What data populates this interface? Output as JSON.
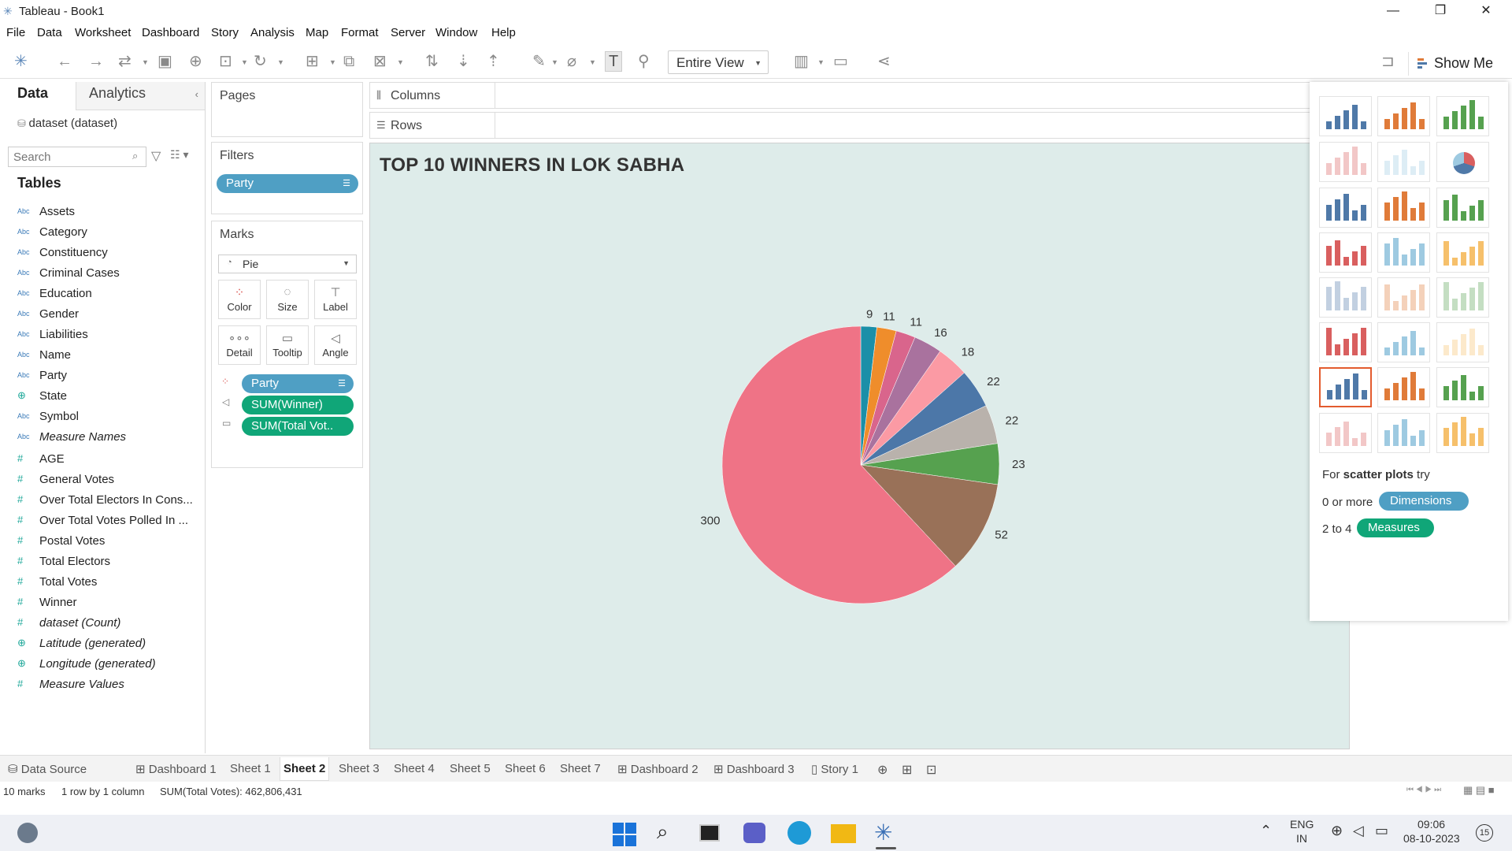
{
  "window": {
    "title": "Tableau - Book1",
    "minimize": "—",
    "restore": "❐",
    "close": "✕"
  },
  "menu": [
    "File",
    "Data",
    "Worksheet",
    "Dashboard",
    "Story",
    "Analysis",
    "Map",
    "Format",
    "Server",
    "Window",
    "Help"
  ],
  "toolbar": {
    "view_mode": "Entire View",
    "show_me": "Show Me"
  },
  "left_pane": {
    "tabs": {
      "data": "Data",
      "analytics": "Analytics"
    },
    "datasource": "dataset (dataset)",
    "search_placeholder": "Search",
    "tables_header": "Tables",
    "fields": [
      {
        "type": "Abc",
        "name": "Assets"
      },
      {
        "type": "Abc",
        "name": "Category"
      },
      {
        "type": "Abc",
        "name": "Constituency"
      },
      {
        "type": "Abc",
        "name": "Criminal Cases"
      },
      {
        "type": "Abc",
        "name": "Education"
      },
      {
        "type": "Abc",
        "name": "Gender"
      },
      {
        "type": "Abc",
        "name": "Liabilities"
      },
      {
        "type": "Abc",
        "name": "Name"
      },
      {
        "type": "Abc",
        "name": "Party"
      },
      {
        "type": "geo",
        "name": "State"
      },
      {
        "type": "Abc",
        "name": "Symbol"
      },
      {
        "type": "Abc",
        "name": "Measure Names",
        "italic": true
      },
      {
        "type": "#",
        "name": "AGE"
      },
      {
        "type": "#",
        "name": "General Votes"
      },
      {
        "type": "#",
        "name": "Over Total Electors  In Cons..."
      },
      {
        "type": "#",
        "name": "Over Total Votes Polled  In ..."
      },
      {
        "type": "#",
        "name": "Postal Votes"
      },
      {
        "type": "#",
        "name": "Total Electors"
      },
      {
        "type": "#",
        "name": "Total Votes"
      },
      {
        "type": "#",
        "name": "Winner"
      },
      {
        "type": "#",
        "name": "dataset (Count)",
        "italic": true
      },
      {
        "type": "geo",
        "name": "Latitude (generated)",
        "italic": true
      },
      {
        "type": "geo",
        "name": "Longitude (generated)",
        "italic": true
      },
      {
        "type": "#",
        "name": "Measure Values",
        "italic": true
      }
    ]
  },
  "shelves": {
    "pages": "Pages",
    "filters": "Filters",
    "filter_pill": "Party",
    "marks": "Marks",
    "mark_type": "Pie",
    "mark_buttons": [
      "Color",
      "Size",
      "Label",
      "Detail",
      "Tooltip",
      "Angle"
    ],
    "mark_pills": [
      "Party",
      "SUM(Winner)",
      "SUM(Total Vot.."
    ],
    "columns": "Columns",
    "rows": "Rows"
  },
  "show_me": {
    "hint_prefix": "For",
    "hint_bold": "scatter plots",
    "hint_suffix": "try",
    "dims_prefix": "0 or more",
    "dims_label": "Dimensions",
    "meas_prefix": "2 to 4",
    "meas_label": "Measures"
  },
  "sheet_tabs": [
    "Data Source",
    "Dashboard 1",
    "Sheet 1",
    "Sheet 2",
    "Sheet 3",
    "Sheet 4",
    "Sheet 5",
    "Sheet 6",
    "Sheet 7",
    "Dashboard 2",
    "Dashboard 3",
    "Story 1"
  ],
  "active_tab": "Sheet 2",
  "status": {
    "marks": "10 marks",
    "dims": "1 row by 1 column",
    "sum": "SUM(Total Votes): 462,806,431"
  },
  "taskbar": {
    "lang1": "ENG",
    "lang2": "IN",
    "time": "09:06",
    "date": "08-10-2023",
    "badge": "15"
  },
  "chart_data": {
    "type": "pie",
    "title": "TOP 10 WINNERS IN LOK SABHA",
    "slices": [
      {
        "value": 9,
        "color": "#1b8fa8"
      },
      {
        "value": 11,
        "color": "#ef8d2b"
      },
      {
        "value": 11,
        "color": "#d9658c"
      },
      {
        "value": 16,
        "color": "#a9729e"
      },
      {
        "value": 18,
        "color": "#fb9aa4"
      },
      {
        "value": 22,
        "color": "#4c77a8"
      },
      {
        "value": 22,
        "color": "#b9b2ac"
      },
      {
        "value": 23,
        "color": "#56a14f"
      },
      {
        "value": 52,
        "color": "#997158"
      },
      {
        "value": 300,
        "color": "#ef7386"
      }
    ]
  }
}
